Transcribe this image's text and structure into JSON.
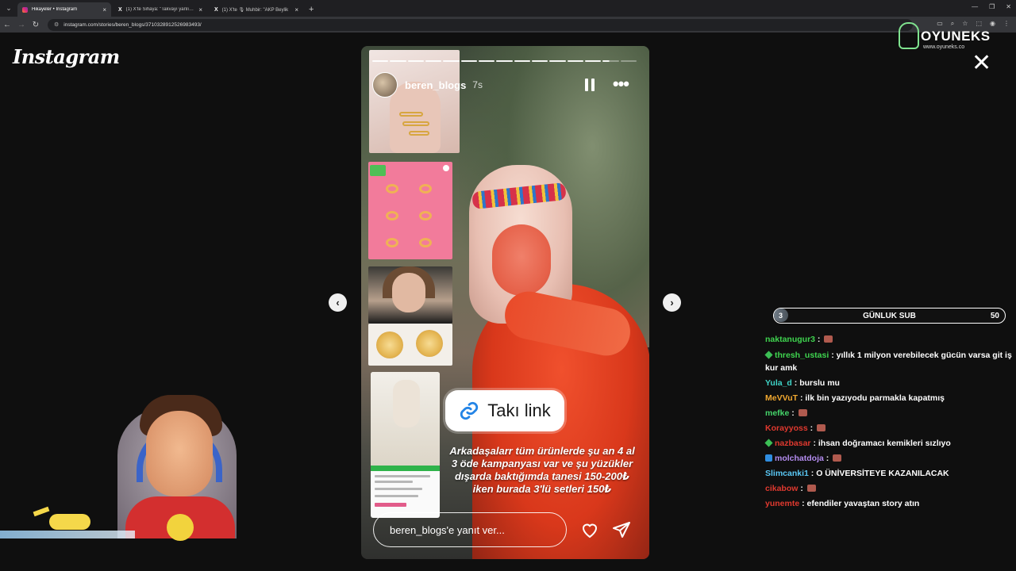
{
  "browser": {
    "tabs": [
      {
        "title": "Hikayeler • Instagram",
        "icon": "instagram-icon",
        "active": true
      },
      {
        "title": "(1) X'te Sihaya: \"Takvayı yanlış a",
        "icon": "x-icon",
        "active": false
      },
      {
        "title": "(1) X'te 🎙 Muhbir: \"AKP Beylik",
        "icon": "x-icon",
        "active": false
      }
    ],
    "url": "instagram.com/stories/beren_blogs/3710328912526983493/"
  },
  "instagram": {
    "logo": "Instagram",
    "story": {
      "username": "beren_blogs",
      "time": "7s",
      "progress": {
        "segments_total": 15,
        "segments_done": 13,
        "current_segment_fraction": 0.4
      },
      "link_sticker": "Takı link",
      "caption": "Arkadaşalarr tüm ürünlerde şu an 4 al 3 öde kampanyası var ve şu yüzükler dışarda baktığımda tanesi 150-200₺ iken burada 3'lü setleri 150₺",
      "reply_placeholder": "beren_blogs'e yanıt ver...",
      "product_card": {
        "brand": "AURRARI",
        "title": "Kadın 3 Lü Bombeli Yüzük Seti",
        "rating": "4.1",
        "reviews": "(1514)",
        "price": "142,49 TL"
      }
    }
  },
  "overlay": {
    "brand": "OYUNEKS",
    "brand_url": "www.oyuneks.co",
    "sub_goal": {
      "label": "GÜNLUK SUB",
      "current": "3",
      "goal": "50",
      "fraction": 0.06
    },
    "chat": [
      {
        "user": "naktanugur3",
        "color": "#3fd44f",
        "text": "",
        "emote": true,
        "badge": ""
      },
      {
        "user": "thresh_ustasi",
        "color": "#3fd44f",
        "text": "yıllık 1 milyon verebilecek gücün varsa git iş kur amk",
        "emote": false,
        "badge": "gem"
      },
      {
        "user": "Yula_d",
        "color": "#3fd4c8",
        "text": "burslu mu",
        "emote": false,
        "badge": ""
      },
      {
        "user": "MeVVuT",
        "color": "#f0a830",
        "text": "ilk bin yazıyodu parmakla kapatmış",
        "emote": false,
        "badge": ""
      },
      {
        "user": "mefke",
        "color": "#45d46a",
        "text": "",
        "emote": true,
        "badge": ""
      },
      {
        "user": "Korayyoss",
        "color": "#e0392f",
        "text": "",
        "emote": true,
        "badge": ""
      },
      {
        "user": "nazbasar",
        "color": "#e0392f",
        "text": "ihsan doğramacı kemikleri sızlıyo",
        "emote": false,
        "badge": "gem"
      },
      {
        "user": "molchatdoja",
        "color": "#b48cf0",
        "text": "",
        "emote": true,
        "badge": "box"
      },
      {
        "user": "Slimcanki1",
        "color": "#5ac8f5",
        "text": "O ÜNİVERSİTEYE KAZANILACAK",
        "emote": false,
        "badge": ""
      },
      {
        "user": "cikabow",
        "color": "#e0392f",
        "text": "",
        "emote": true,
        "badge": ""
      },
      {
        "user": "yunemte",
        "color": "#e0392f",
        "text": "efendiler yavaştan story atın",
        "emote": false,
        "badge": ""
      }
    ]
  }
}
